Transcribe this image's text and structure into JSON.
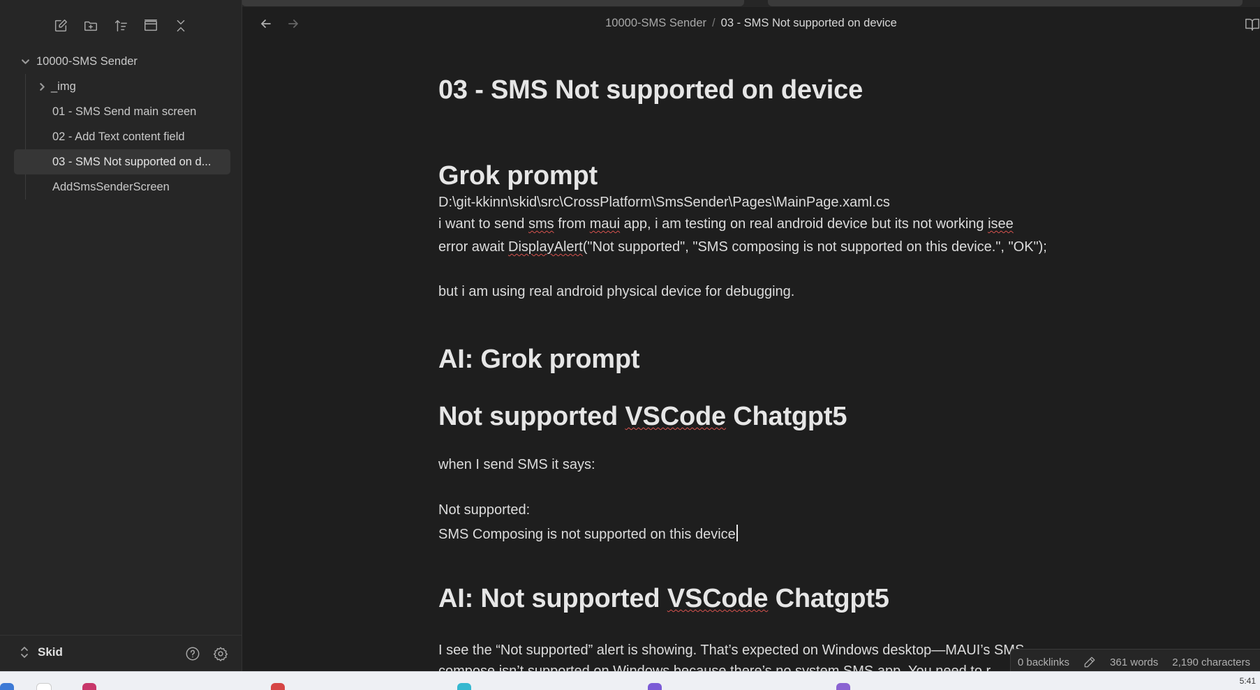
{
  "sidebar": {
    "toolbar": [
      {
        "name": "new-note-icon"
      },
      {
        "name": "new-folder-icon"
      },
      {
        "name": "sort-icon"
      },
      {
        "name": "collapse-view-icon"
      },
      {
        "name": "collapse-all-icon"
      }
    ],
    "tree": {
      "root": "10000-SMS Sender",
      "folder": "_img",
      "items": [
        "01 - SMS Send main screen",
        "02 - Add Text content field",
        "03 - SMS Not supported on d...",
        "AddSmsSenderScreen"
      ],
      "active_index": 2
    },
    "vault_name": "Skid"
  },
  "header": {
    "breadcrumb_parent": "10000-SMS Sender",
    "breadcrumb_separator": "/",
    "breadcrumb_current": "03 - SMS Not supported on device"
  },
  "note": {
    "title": "03 - SMS Not supported on device",
    "h_grok": "Grok prompt",
    "path": "D:\\git-kkinn\\skid\\src\\CrossPlatform\\SmsSender\\Pages\\MainPage.xaml.cs",
    "line1": {
      "a": "i want to send ",
      "b": "sms",
      "c": " from ",
      "d": "maui",
      "e": " app, i am testing on real android device but its not working ",
      "f": "isee"
    },
    "line2": {
      "a": "error await ",
      "b": "DisplayAlert",
      "c": "(\"Not supported\", \"SMS composing is not supported on this device.\", \"OK\");"
    },
    "line3": "but i am using real android physical device for debugging.",
    "h_ai_grok": "AI: Grok prompt",
    "h_vscode": {
      "a": "Not supported ",
      "b": "VSCode",
      "c": " Chatgpt5"
    },
    "line4": "when I send SMS it says:",
    "line5": "Not supported:",
    "line6": "SMS Composing is not supported on this device",
    "h_ai_vscode": {
      "a": "AI: Not supported ",
      "b": "VSCode",
      "c": " Chatgpt5"
    },
    "line7": "I see the “Not supported” alert is showing. That’s expected on Windows desktop—MAUI’s SMS",
    "line8": "compose isn’t supported on Windows because there’s no system SMS app. You need to r"
  },
  "status": {
    "backlinks": "0 backlinks",
    "words": "361 words",
    "characters": "2,190 characters"
  },
  "taskbar": {
    "clock": "5:41"
  },
  "colors": {
    "background": "#1e1e1e",
    "sidebar": "#262626",
    "active_item": "#363636",
    "text": "#dcdcdc",
    "spellcheck": "#d9534f"
  }
}
